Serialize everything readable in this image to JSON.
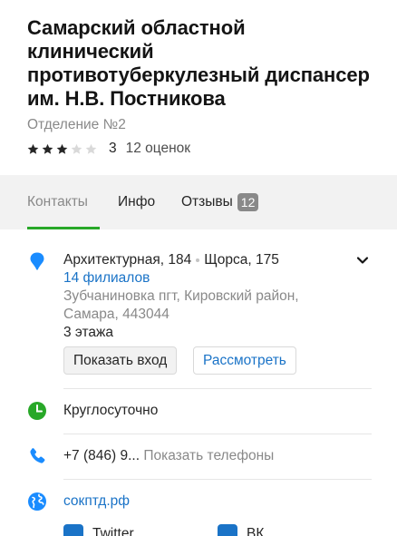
{
  "header": {
    "title": "Самарский областной клинический противотуберкулезный диспансер им. Н.В. Постникова",
    "subtitle": "Отделение №2",
    "rating": {
      "value": "3",
      "stars_filled": 3,
      "stars_total": 5,
      "count": "12 оценок"
    }
  },
  "tabs": [
    {
      "label": "Контакты",
      "active": true
    },
    {
      "label": "Инфо",
      "active": false
    },
    {
      "label": "Отзывы",
      "active": false,
      "badge": "12"
    }
  ],
  "address": {
    "street": "Архитектурная, 184",
    "cross_street": "Щорса, 175",
    "branches": "14 филиалов",
    "district": "Зубчаниновка пгт, Кировский район, Самара, 443044",
    "floors": "3 этажа",
    "show_entrance": "Показать вход",
    "view": "Рассмотреть"
  },
  "hours": {
    "text": "Круглосуточно"
  },
  "phone": {
    "partial": "+7 (846) 9...",
    "show_label": "Показать телефоны"
  },
  "website": {
    "url": "сокптд.рф"
  },
  "socials": [
    {
      "label": "Twitter",
      "icon": "twitter-icon"
    },
    {
      "label": "ВК",
      "icon": "vk-icon"
    }
  ],
  "colors": {
    "accent_green": "#28a828",
    "link_blue": "#1a73c7",
    "pin_blue": "#1a8cff"
  }
}
